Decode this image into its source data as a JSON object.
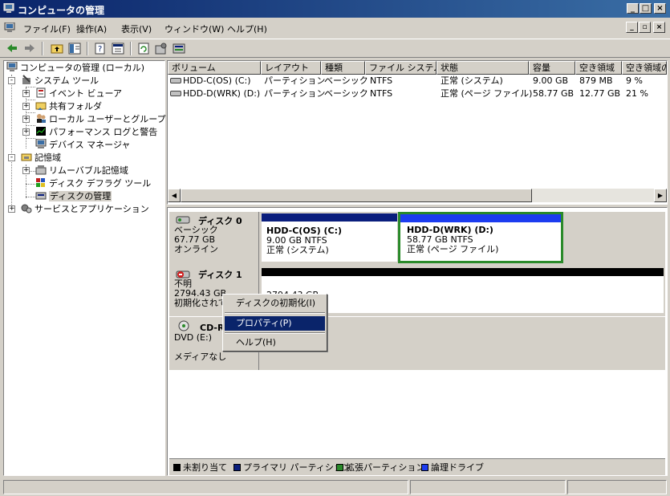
{
  "window": {
    "title": "コンピュータの管理"
  },
  "menu": {
    "items": [
      "ファイル(F)",
      "操作(A)",
      "表示(V)",
      "ウィンドウ(W)",
      "ヘルプ(H)"
    ]
  },
  "tree": {
    "root": "コンピュータの管理 (ローカル)",
    "system_tools": "システム ツール",
    "event_viewer": "イベント ビューア",
    "shared_folders": "共有フォルダ",
    "local_users": "ローカル ユーザーとグループ",
    "perf_logs": "パフォーマンス ログと警告",
    "device_manager": "デバイス マネージャ",
    "storage": "記憶域",
    "removable": "リムーバブル記憶域",
    "defrag": "ディスク デフラグ ツール",
    "disk_mgmt": "ディスクの管理",
    "services": "サービスとアプリケーション"
  },
  "volume_list": {
    "columns": [
      "ボリューム",
      "レイアウト",
      "種類",
      "ファイル システム",
      "状態",
      "容量",
      "空き領域",
      "空き領域の"
    ],
    "rows": [
      [
        "HDD-C(OS) (C:)",
        "パーティション",
        "ベーシック",
        "NTFS",
        "正常 (システム)",
        "9.00 GB",
        "879 MB",
        "9 %"
      ],
      [
        "HDD-D(WRK) (D:)",
        "パーティション",
        "ベーシック",
        "NTFS",
        "正常 (ページ ファイル)",
        "58.77 GB",
        "12.77 GB",
        "21 %"
      ]
    ]
  },
  "disks": {
    "disk0": {
      "name": "ディスク 0",
      "type": "ベーシック",
      "size": "67.77 GB",
      "status": "オンライン",
      "part_c": {
        "name": "HDD-C(OS)  (C:)",
        "size": "9.00 GB NTFS",
        "status": "正常 (システム)"
      },
      "part_d": {
        "name": "HDD-D(WRK)  (D:)",
        "size": "58.77 GB NTFS",
        "status": "正常 (ページ ファイル)"
      }
    },
    "disk1": {
      "name": "ディスク 1",
      "type": "不明",
      "size": "2794.43 GB",
      "status": "初期化されて",
      "part_size": "2794.43 GB"
    },
    "cdrom0": {
      "name": "CD-R",
      "drive": "DVD (E:)",
      "status": "メディアなし"
    }
  },
  "legend": {
    "unallocated": "未割り当て",
    "primary": "プライマリ パーティション",
    "extended": "拡張パーティション",
    "logical": "論理ドライブ",
    "colors": {
      "unallocated": "#000000",
      "primary": "#0a1e7d",
      "extended": "#2a8a2a",
      "logical": "#1c3cf0"
    }
  },
  "context_menu": {
    "items": [
      "ディスクの初期化(I)",
      "プロパティ(P)",
      "ヘルプ(H)"
    ]
  }
}
